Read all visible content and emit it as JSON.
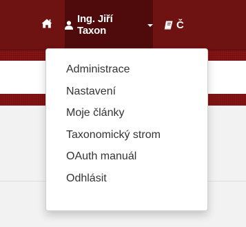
{
  "navbar": {
    "user_label": "Ing. Jiří Taxon",
    "articles_label": "Č",
    "background_color": "#6e1212",
    "active_background_color": "#4f0b0b",
    "icons": {
      "home": "home-icon",
      "user": "user-icon",
      "caret": "caret-down-icon",
      "articles": "book-icon"
    }
  },
  "dropdown": {
    "items": [
      {
        "label": "Administrace"
      },
      {
        "label": "Nastavení"
      },
      {
        "label": "Moje články"
      },
      {
        "label": "Taxonomický strom"
      },
      {
        "label": "OAuth manuál"
      },
      {
        "label": "Odhlásit"
      }
    ]
  },
  "colors": {
    "band": "#8c1515",
    "page_background": "#f2f2f2",
    "menu_text": "#333333"
  }
}
